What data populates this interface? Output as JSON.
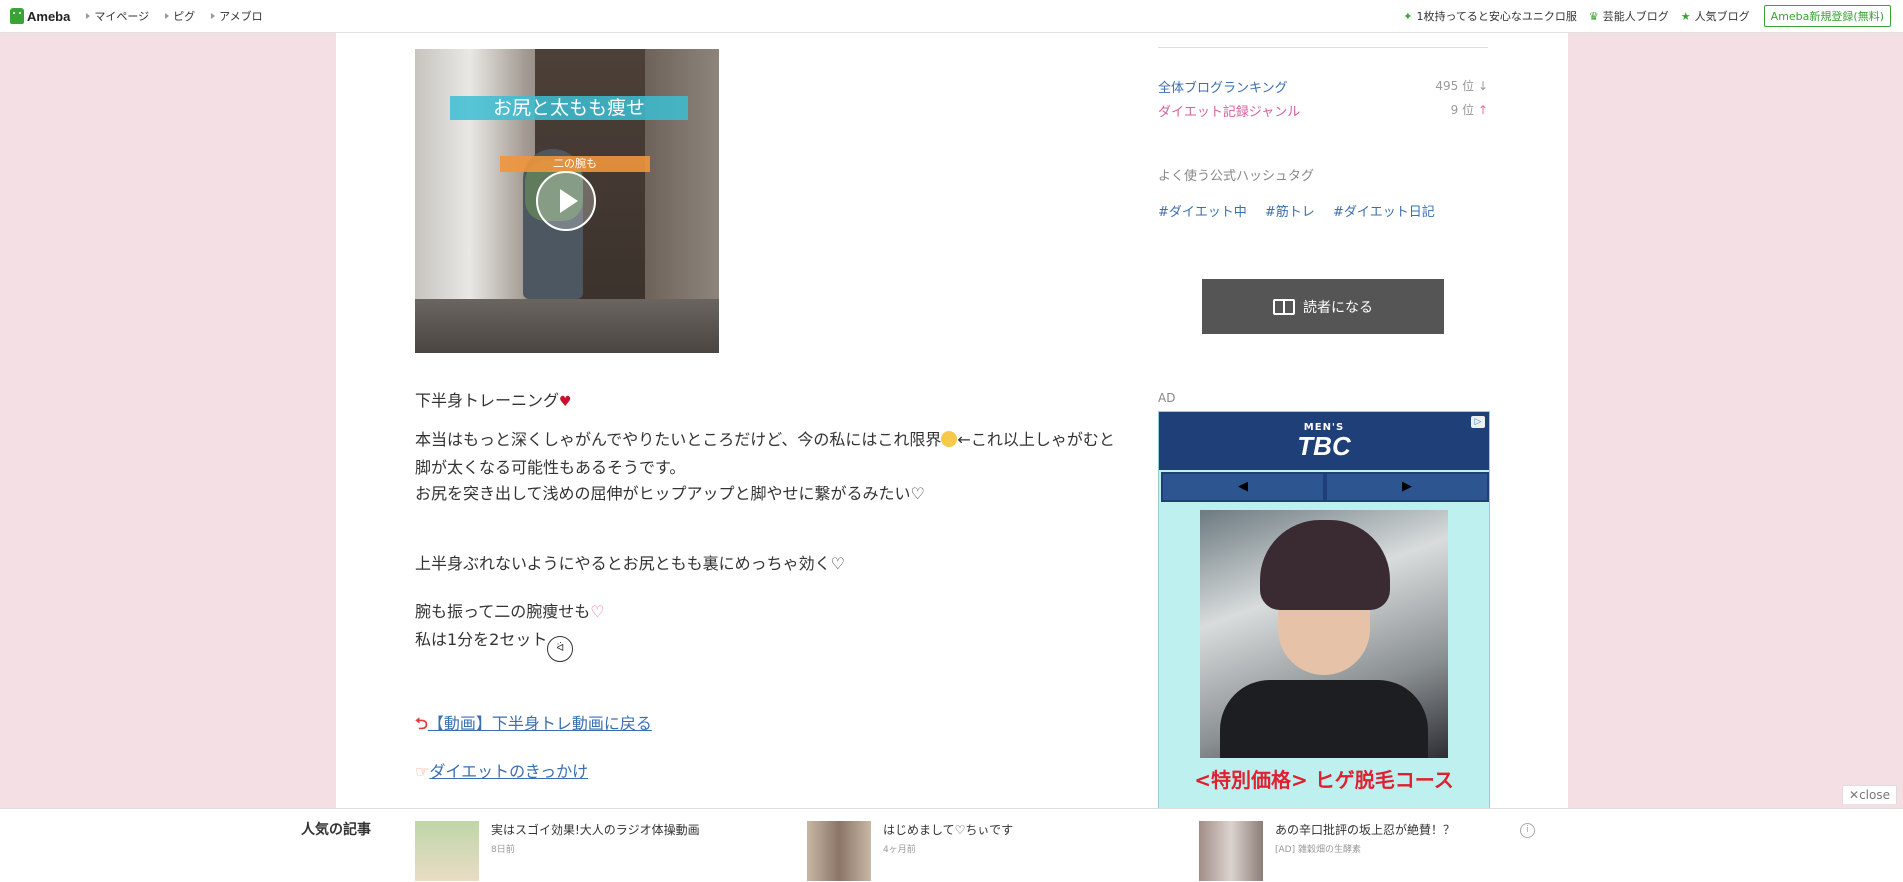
{
  "topbar": {
    "logo": "Ameba",
    "nav": [
      "マイページ",
      "ピグ",
      "アメブロ"
    ],
    "right": [
      {
        "icon": "sparkle-icon",
        "label": "1枚持ってると安心なユニクロ服"
      },
      {
        "icon": "crown-icon",
        "label": "芸能人ブログ"
      },
      {
        "icon": "star-icon",
        "label": "人気ブログ"
      }
    ],
    "signup": "Ameba新規登録(無料)"
  },
  "video": {
    "title": "お尻と太もも痩せ",
    "subtitle": "二の腕も"
  },
  "article": {
    "line1": "下半身トレーニング",
    "para1a": "本当はもっと深くしゃがんでやりたいところだけど、今の私にはこれ限界",
    "para1b": "←これ以上しゃがむと脚が太くなる可能性もあるそうです。",
    "para1c": "お尻を突き出して浅めの屈伸がヒップアップと脚やせに繋がるみたい♡",
    "para2": "上半身ぶれないようにやるとお尻ともも裏にめっちゃ効く♡",
    "para3": "腕も振って二の腕痩せも",
    "para4": "私は1分を2セット",
    "link1": "【動画】下半身トレ動画に戻る",
    "link2": "ダイエットのきっかけ"
  },
  "sidebar": {
    "rank_overall_label": "全体ブログランキング",
    "rank_overall_value": "495 位",
    "rank_overall_arrow": "↓",
    "rank_genre_label": "ダイエット記録ジャンル",
    "rank_genre_value": "9 位",
    "rank_genre_arrow": "↑",
    "hashtag_title": "よく使う公式ハッシュタグ",
    "hashtags": [
      "#ダイエット中",
      "#筋トレ",
      "#ダイエット日記"
    ],
    "reader_button": "読者になる",
    "ad_label": "AD"
  },
  "ad": {
    "brand_small": "MEN'S",
    "brand": "TBC",
    "prev": "◀",
    "next": "▶",
    "offer": "<特別価格> ヒゲ脱毛コース",
    "choice_icon": "▷"
  },
  "bottom": {
    "title": "人気の記事",
    "items": [
      {
        "title": "実はスゴイ効果!大人のラジオ体操動画",
        "sub": "8日前"
      },
      {
        "title": "はじめまして♡ちぃです",
        "sub": "4ヶ月前"
      },
      {
        "title": "あの辛口批評の坂上忍が絶賛！？",
        "sub": "[AD] 雑穀畑の生酵素"
      }
    ],
    "close": "close"
  },
  "colors": {
    "page_bg": "#f4dfe5",
    "link_blue": "#3a6fb0",
    "genre_pink": "#d65fa0",
    "ameba_green": "#3aa335",
    "ad_navy": "#1f3f78",
    "ad_red": "#e11f2e"
  }
}
